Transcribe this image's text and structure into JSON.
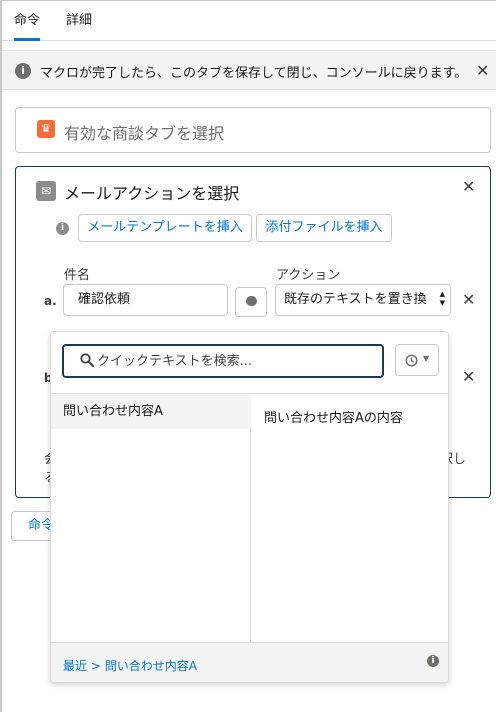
{
  "tabs": [
    {
      "label": "命令",
      "active": true
    },
    {
      "label": "詳細",
      "active": false
    }
  ],
  "banner": {
    "icon": "info-icon",
    "text": "マクロが完了したら、このタブを保存して閉じ、コンソールに戻ります。",
    "close_icon": "close-icon"
  },
  "step1": {
    "icon": "opportunity-icon",
    "title": "有効な商談タブを選択"
  },
  "step2": {
    "icon": "email-icon",
    "title": "メールアクションを選択",
    "insert_template_label": "メールテンプレートを挿入",
    "insert_attachment_label": "添付ファイルを挿入",
    "subject_label": "件名",
    "action_label": "アクション",
    "row_a": {
      "marker": "a.",
      "subject_value": "確認依頼",
      "action_value": "既存のテキストを置き換"
    },
    "row_b": {
      "marker": "b"
    },
    "obscured_left_text": [
      "会",
      "る"
    ],
    "obscured_right_text": [
      "択し",
      "。"
    ]
  },
  "command_button_label": "命令",
  "quick_text": {
    "search_placeholder": "クイックテキストを検索...",
    "search_value": "",
    "items": [
      {
        "label": "問い合わせ内容A",
        "selected": true
      }
    ],
    "preview": "問い合わせ内容Aの内容",
    "breadcrumb": {
      "root": "最近",
      "separator": ">",
      "current": "問い合わせ内容A"
    }
  },
  "colors": {
    "brand_blue": "#0176d3",
    "navy_border": "#1b3a57",
    "opportunity_orange": "#ef6e3c"
  }
}
